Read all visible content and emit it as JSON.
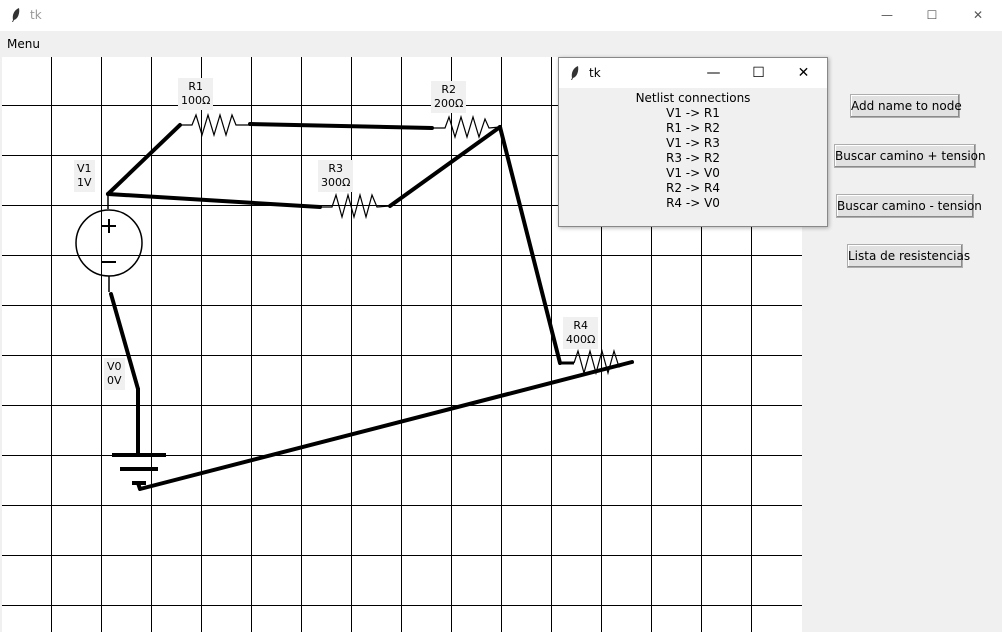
{
  "window": {
    "title": "tk",
    "minimize": "—",
    "maximize": "☐",
    "close": "✕"
  },
  "menubar": {
    "menu_label": "Menu"
  },
  "labels": {
    "r1": [
      "R1",
      "100Ω"
    ],
    "r2": [
      "R2",
      "200Ω"
    ],
    "r3": [
      "R3",
      "300Ω"
    ],
    "r4": [
      "R4",
      "400Ω"
    ],
    "v1": [
      "V1",
      "1V"
    ],
    "v0": [
      "V0",
      "0V"
    ]
  },
  "buttons": {
    "add_name": "Add name to node",
    "path_plus": "Buscar camino + tension",
    "path_minus": "Buscar camino - tension",
    "resistor_list": "Lista de resistencias"
  },
  "popup": {
    "title": "tk",
    "heading": "Netlist connections",
    "connections": [
      "V1 -> R1",
      "R1 -> R2",
      "V1 -> R3",
      "R3 -> R2",
      "V1 -> V0",
      "R2 -> R4",
      "R4 -> V0"
    ]
  }
}
